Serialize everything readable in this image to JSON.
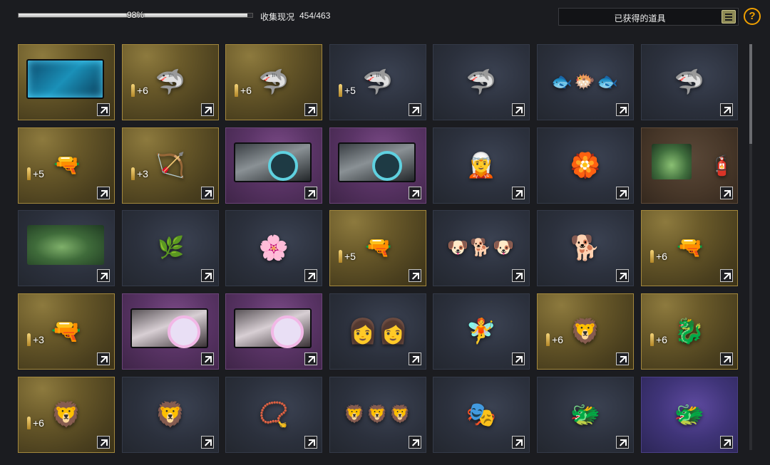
{
  "header": {
    "progress_percent": 98,
    "progress_label": "98%",
    "collect_label": "收集现况",
    "collect_count": "454/463",
    "filter_label": "已获得的道具",
    "help_symbol": "?"
  },
  "colors": {
    "help_accent": "#f0a000",
    "tile_gold": "#a3883d",
    "tile_blue": "#343a48",
    "tile_purple": "#6b4478",
    "tile_violet": "#4a3f86",
    "tile_brown": "#5e4a38"
  },
  "items": [
    {
      "name": "circuit-card",
      "rarity": "gold",
      "banner": "circuit",
      "bonus": ""
    },
    {
      "name": "purple-shark",
      "rarity": "gold",
      "art": "🦈",
      "bonus": "+6"
    },
    {
      "name": "blue-shark",
      "rarity": "gold",
      "art": "🦈",
      "bonus": "+6"
    },
    {
      "name": "ice-shark",
      "rarity": "blue",
      "art": "🦈",
      "bonus": "+5"
    },
    {
      "name": "dark-shark",
      "rarity": "blue",
      "art": "🦈",
      "bonus": ""
    },
    {
      "name": "shark-set",
      "rarity": "blue",
      "art": "🐟🐡🐟",
      "small": true,
      "bonus": ""
    },
    {
      "name": "shark-mascot",
      "rarity": "blue",
      "art": "🦈",
      "bonus": ""
    },
    {
      "name": "sniper-rifle",
      "rarity": "gold",
      "art": "🔫",
      "wide": true,
      "bonus": "+5"
    },
    {
      "name": "crossbow",
      "rarity": "gold",
      "art": "🏹",
      "bonus": "+3"
    },
    {
      "name": "scope-card",
      "rarity": "purple",
      "banner": "scope",
      "bonus": ""
    },
    {
      "name": "scope-card-2",
      "rarity": "purple",
      "banner": "scope",
      "bonus": ""
    },
    {
      "name": "elf-figure",
      "rarity": "blue",
      "art": "🧝",
      "bonus": ""
    },
    {
      "name": "star-badge",
      "rarity": "blue",
      "art": "🏵️",
      "bonus": ""
    },
    {
      "name": "spray-set",
      "rarity": "brown",
      "banner": "forest-small",
      "art": "🧯",
      "bonus": ""
    },
    {
      "name": "forest-card",
      "rarity": "blue",
      "banner": "forest",
      "bonus": ""
    },
    {
      "name": "flower-garland",
      "rarity": "blue",
      "art": "🌿",
      "wide": true,
      "bonus": ""
    },
    {
      "name": "white-lily",
      "rarity": "blue",
      "art": "🌸",
      "bonus": ""
    },
    {
      "name": "long-rifle",
      "rarity": "gold",
      "art": "🔫",
      "wide": true,
      "bonus": "+5"
    },
    {
      "name": "dog-set",
      "rarity": "blue",
      "art": "🐶🐕🐶",
      "small": true,
      "bonus": ""
    },
    {
      "name": "shiba-dog",
      "rarity": "blue",
      "art": "🐕",
      "bonus": ""
    },
    {
      "name": "pink-rifle",
      "rarity": "gold",
      "art": "🔫",
      "wide": true,
      "bonus": "+6"
    },
    {
      "name": "pink-pistol",
      "rarity": "gold",
      "art": "🔫",
      "bonus": "+3"
    },
    {
      "name": "pink-scope-card",
      "rarity": "purple",
      "banner": "pinkscope",
      "bonus": ""
    },
    {
      "name": "pink-scope-card-2",
      "rarity": "purple",
      "banner": "pinkscope",
      "bonus": ""
    },
    {
      "name": "two-characters",
      "rarity": "blue",
      "art": "👩👩",
      "bonus": ""
    },
    {
      "name": "flower-girl",
      "rarity": "blue",
      "art": "🧚",
      "bonus": ""
    },
    {
      "name": "lion-pet",
      "rarity": "gold",
      "art": "🦁",
      "bonus": "+6"
    },
    {
      "name": "dragon-pet",
      "rarity": "gold",
      "art": "🐉",
      "bonus": "+6"
    },
    {
      "name": "lion-pet-2",
      "rarity": "gold",
      "art": "🦁",
      "bonus": "+6"
    },
    {
      "name": "lion-dance-pet",
      "rarity": "blue",
      "art": "🦁",
      "bonus": ""
    },
    {
      "name": "lucky-bracelet",
      "rarity": "blue",
      "art": "📿",
      "bonus": ""
    },
    {
      "name": "lion-dance-set",
      "rarity": "blue",
      "art": "🦁🦁🦁",
      "small": true,
      "bonus": ""
    },
    {
      "name": "lion-dance-head",
      "rarity": "blue",
      "art": "🎭",
      "bonus": ""
    },
    {
      "name": "dragon-figure",
      "rarity": "blue",
      "art": "🐲",
      "bonus": ""
    },
    {
      "name": "purple-dragon-pet",
      "rarity": "violet",
      "art": "🐲",
      "bonus": ""
    }
  ]
}
